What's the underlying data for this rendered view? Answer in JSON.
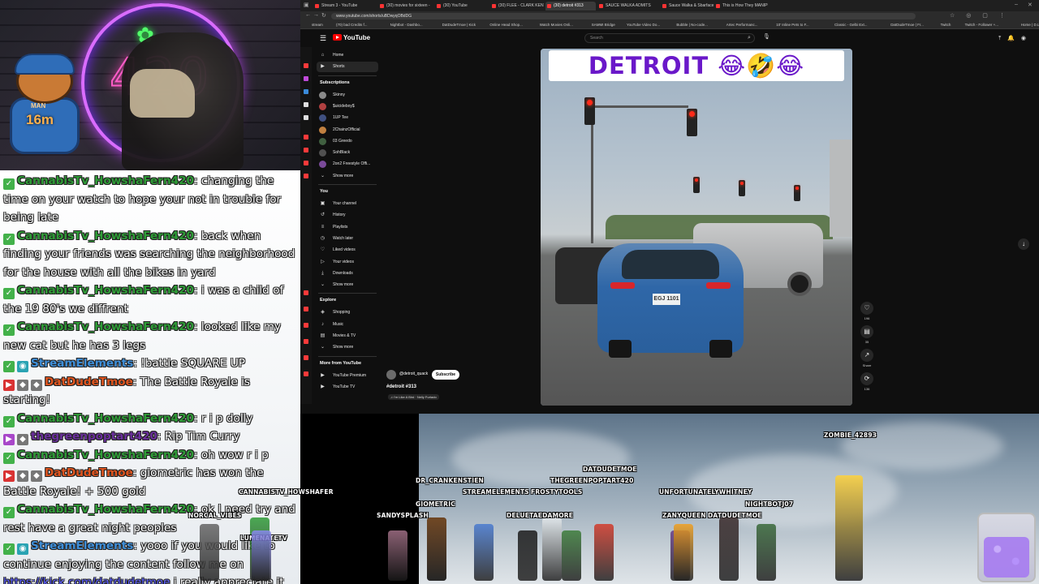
{
  "chat": {
    "messages": [
      {
        "badges": [
          "green"
        ],
        "user": "CannabisTv_HowshaFern420",
        "user_color": "#2f9c37",
        "text": ": changing the time on your watch to hope your not in trouble for being late"
      },
      {
        "badges": [
          "green"
        ],
        "user": "CannabisTv_HowshaFern420",
        "user_color": "#2f9c37",
        "text": ": back when finding your friends was searching the neighborhood for the house with all the bikes in yard"
      },
      {
        "badges": [
          "green"
        ],
        "user": "CannabisTv_HowshaFern420",
        "user_color": "#2f9c37",
        "text": ": i was a child of the 19 80's we diffrent"
      },
      {
        "badges": [
          "green"
        ],
        "user": "CannabisTv_HowshaFern420",
        "user_color": "#2f9c37",
        "text": ": looked like my new cat but he has 3 legs"
      },
      {
        "badges": [
          "green",
          "teal"
        ],
        "user": "StreamElements",
        "user_color": "#3f8fd9",
        "text": ": !battle SQUARE UP"
      },
      {
        "badges": [
          "red",
          "gray",
          "gray"
        ],
        "user": "DatDudeTmoe",
        "user_color": "#e0551f",
        "text": ": The Battle Royale is starting!"
      },
      {
        "badges": [
          "green"
        ],
        "user": "CannabisTv_HowshaFern420",
        "user_color": "#2f9c37",
        "text": ": r i p dolly"
      },
      {
        "badges": [
          "purple",
          "gray"
        ],
        "user": "thegreenpoptart420",
        "user_color": "#6a2f9c",
        "text": ": Rip Tim Curry"
      },
      {
        "badges": [
          "green"
        ],
        "user": "CannabisTv_HowshaFern420",
        "user_color": "#2f9c37",
        "text": ": oh wow r i p"
      },
      {
        "badges": [
          "red",
          "gray",
          "gray"
        ],
        "user": "DatDudeTmoe",
        "user_color": "#e0551f",
        "text": ": giometric has won the Battle Royale! + 500 gold"
      },
      {
        "badges": [
          "green"
        ],
        "user": "CannabisTv_HowshaFern420",
        "user_color": "#2f9c37",
        "text": ": ok I need try and rest have a great night peoples"
      },
      {
        "badges": [
          "green",
          "teal"
        ],
        "user": "StreamElements",
        "user_color": "#3f8fd9",
        "text": ": yooo if you would like to continue enjoying the content follow me on"
      },
      {
        "badges": [],
        "user": "",
        "user_color": "#5a5cff",
        "link": "https://kick.com/datdudetmoe",
        "text": " i really appreciate it"
      }
    ]
  },
  "webcam": {
    "neon_sign": "420",
    "bear_badge": "16m",
    "bear_badge_top": "MAN"
  },
  "browser": {
    "tabs": [
      {
        "label": "Stream 3 - YouTube",
        "active": false
      },
      {
        "label": "(30) movies for sixteen -",
        "active": false
      },
      {
        "label": "(30) YouTube",
        "active": false
      },
      {
        "label": "(30) FLEE - CLARK KENT",
        "active": false
      },
      {
        "label": "(30) detroit #313",
        "active": true
      },
      {
        "label": "SAUCE WALKA ADMITS T",
        "active": false
      },
      {
        "label": "Sauce Walka & Sbarface -",
        "active": false
      },
      {
        "label": "This is How They MANIPU",
        "active": false
      }
    ],
    "url": "www.youtube.com/shorts/uBDwyqOBdDG",
    "bookmarks": [
      "stream",
      "(70) bad Credits f...",
      "Nightbot - Dashbo...",
      "DatDudeTmoe | Kick",
      "Online Head Shop...",
      "Watch Movies Onli...",
      "SAMMI Bridge",
      "YouTube Video Do...",
      "Bubble | No-code...",
      "Artec Performanc...",
      "10' Inline Pets to F...",
      "Classic - Gelbi Ext...",
      "DatDudeTmoe | Fr...",
      "Twitch",
      "Twitch - Follower +...",
      "Home | D.LF",
      "Apartments | Lake..."
    ]
  },
  "youtube": {
    "logo": "YouTube",
    "search_placeholder": "Search",
    "nav": [
      {
        "label": "Home",
        "icon": "home-icon",
        "glyph": "⌂",
        "active": false
      },
      {
        "label": "Shorts",
        "icon": "shorts-icon",
        "glyph": "▶",
        "active": true
      }
    ],
    "subscriptions_header": "Subscriptions",
    "subscriptions": [
      "Skinny",
      "$uicideboy$",
      "1UP Tee",
      "2ChainzOfficial",
      "03 Greedo",
      "SohBlack",
      "2on2 Freestyle Offi..."
    ],
    "show_more_1": "Show more",
    "you_header": "You",
    "you_items": [
      {
        "label": "Your channel",
        "glyph": "▣"
      },
      {
        "label": "History",
        "glyph": "↺"
      },
      {
        "label": "Playlists",
        "glyph": "≡"
      },
      {
        "label": "Watch later",
        "glyph": "◷"
      },
      {
        "label": "Liked videos",
        "glyph": "♡"
      },
      {
        "label": "Your videos",
        "glyph": "▷"
      },
      {
        "label": "Downloads",
        "glyph": "⤓"
      }
    ],
    "show_more_2": "Show more",
    "explore_header": "Explore",
    "explore_items": [
      {
        "label": "Shopping",
        "glyph": "◈"
      },
      {
        "label": "Music",
        "glyph": "♪"
      },
      {
        "label": "Movies & TV",
        "glyph": "▤"
      }
    ],
    "show_more_3": "Show more",
    "more_header": "More from YouTube",
    "more_items": [
      "YouTube Premium",
      "YouTube TV"
    ],
    "short_title_overlay": "DETROIT 😂🤣😂",
    "plate": "EGJ 1101",
    "channel_name": "@detroit_quack",
    "subscribe": "Subscribe",
    "video_title": "#detroit #313",
    "music": "♫ I'm Like A Bird · Nelly Furtado",
    "side_actions": [
      {
        "icon": "like-icon",
        "glyph": "♡",
        "count": "196"
      },
      {
        "icon": "comment-icon",
        "glyph": "▤",
        "count": "35"
      },
      {
        "icon": "share-icon",
        "glyph": "↗",
        "count": "Share"
      },
      {
        "icon": "remix-icon",
        "glyph": "⟳",
        "count": "136"
      }
    ]
  },
  "battle": {
    "names": [
      {
        "name": "ZOMBIE_42893",
        "color": "#ffd23a"
      },
      {
        "name": "DATDUDETMOE",
        "color": "#d43a2a"
      },
      {
        "name": "DR_CRANKENSTIEN",
        "color": "#2b2b2b"
      },
      {
        "name": "THEGREENPOPTART420",
        "color": "#3d7d3a"
      },
      {
        "name": "STREAMELEMENTS",
        "color": "#4a7bd0"
      },
      {
        "name": "FROSTYTOOLS",
        "color": "#e7ecef"
      },
      {
        "name": "UNFORTUNATELYWHITNEY",
        "color": "#6a3d8a"
      },
      {
        "name": "NIGHTBOTJ07",
        "color": "#3a6a3a"
      },
      {
        "name": "GIOMETRIC",
        "color": "#7a4a20"
      },
      {
        "name": "DELUETAEDAMORE",
        "color": "#1b1b1b"
      },
      {
        "name": "ZANYQUEEN",
        "color": "#f0a020"
      },
      {
        "name": "DATDUDETMOE",
        "color": "#3a2a2a"
      },
      {
        "name": "SANDYSPLASH",
        "color": "#e6a0c0"
      },
      {
        "name": "NORCAL_VIBES",
        "color": "#666"
      },
      {
        "name": "CANNABISTV_HOWSHAFER",
        "color": "#2f9c37"
      },
      {
        "name": "LUMENATETV",
        "color": "#8a8af0"
      }
    ]
  }
}
